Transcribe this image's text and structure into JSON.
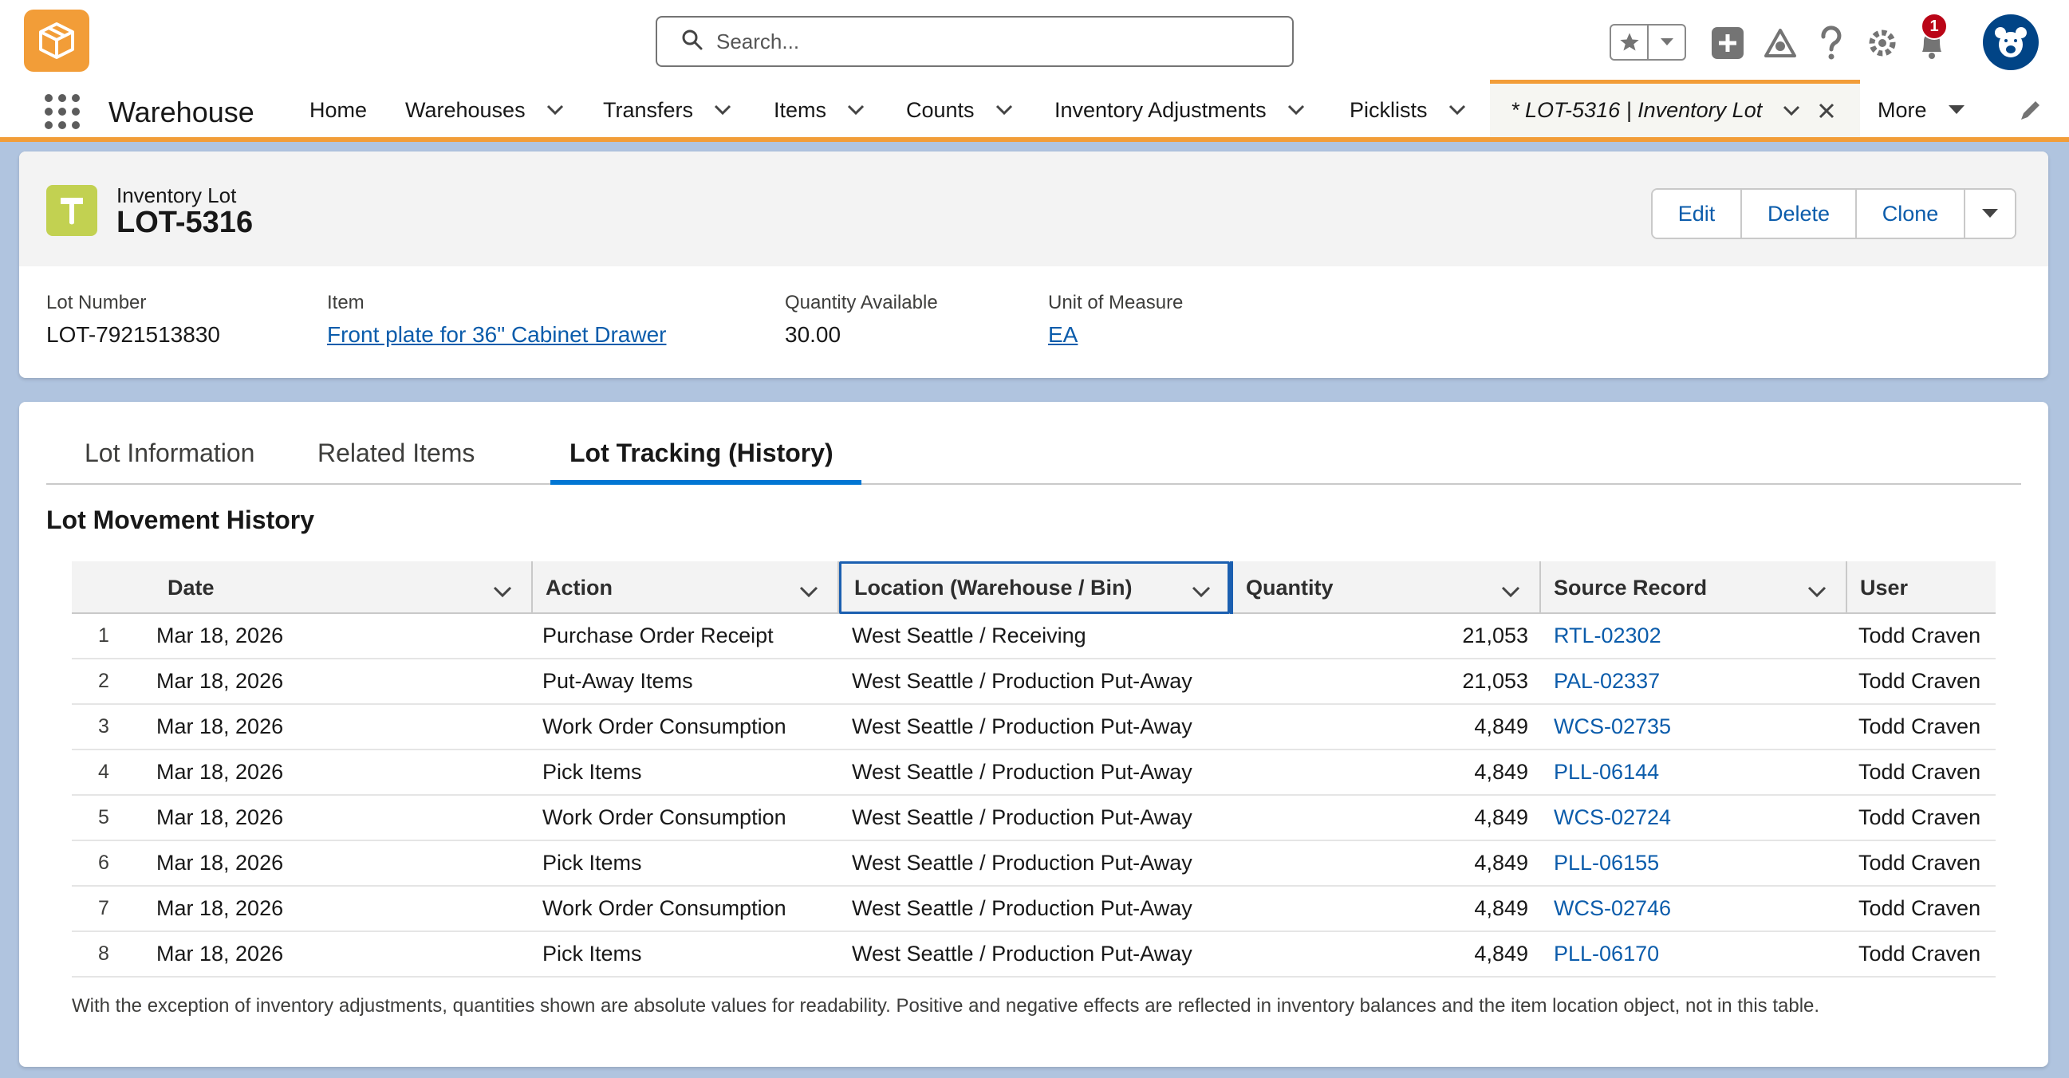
{
  "header": {
    "search_placeholder": "Search...",
    "notification_count": "1"
  },
  "nav": {
    "app_name": "Warehouse",
    "items": [
      {
        "label": "Home"
      },
      {
        "label": "Warehouses"
      },
      {
        "label": "Transfers"
      },
      {
        "label": "Items"
      },
      {
        "label": "Counts"
      },
      {
        "label": "Inventory Adjustments"
      },
      {
        "label": "Picklists"
      }
    ],
    "active_tab": "* LOT-5316 | Inventory Lot",
    "more_label": "More"
  },
  "record": {
    "object_label": "Inventory Lot",
    "title": "LOT-5316",
    "actions": {
      "edit": "Edit",
      "delete": "Delete",
      "clone": "Clone"
    },
    "fields": [
      {
        "label": "Lot Number",
        "value": "LOT-7921513830"
      },
      {
        "label": "Item",
        "value": "Front plate for 36\" Cabinet Drawer"
      },
      {
        "label": "Quantity Available",
        "value": "30.00"
      },
      {
        "label": "Unit of Measure",
        "value": "EA"
      }
    ]
  },
  "tabs": [
    {
      "label": "Lot Information"
    },
    {
      "label": "Related Items"
    },
    {
      "label": "Lot Tracking (History)"
    }
  ],
  "history": {
    "title": "Lot Movement History",
    "columns": [
      "Date",
      "Action",
      "Location (Warehouse / Bin)",
      "Quantity",
      "Source Record",
      "User"
    ],
    "rows": [
      {
        "n": "1",
        "date": "Mar 18, 2026",
        "action": "Purchase Order Receipt",
        "location": "West Seattle / Receiving",
        "qty": "21,053",
        "source": "RTL-02302",
        "user": "Todd Craven"
      },
      {
        "n": "2",
        "date": "Mar 18, 2026",
        "action": "Put-Away Items",
        "location": "West Seattle / Production Put-Away",
        "qty": "21,053",
        "source": "PAL-02337",
        "user": "Todd Craven"
      },
      {
        "n": "3",
        "date": "Mar 18, 2026",
        "action": "Work Order Consumption",
        "location": "West Seattle / Production Put-Away",
        "qty": "4,849",
        "source": "WCS-02735",
        "user": "Todd Craven"
      },
      {
        "n": "4",
        "date": "Mar 18, 2026",
        "action": "Pick Items",
        "location": "West Seattle / Production Put-Away",
        "qty": "4,849",
        "source": "PLL-06144",
        "user": "Todd Craven"
      },
      {
        "n": "5",
        "date": "Mar 18, 2026",
        "action": "Work Order Consumption",
        "location": "West Seattle / Production Put-Away",
        "qty": "4,849",
        "source": "WCS-02724",
        "user": "Todd Craven"
      },
      {
        "n": "6",
        "date": "Mar 18, 2026",
        "action": "Pick Items",
        "location": "West Seattle / Production Put-Away",
        "qty": "4,849",
        "source": "PLL-06155",
        "user": "Todd Craven"
      },
      {
        "n": "7",
        "date": "Mar 18, 2026",
        "action": "Work Order Consumption",
        "location": "West Seattle / Production Put-Away",
        "qty": "4,849",
        "source": "WCS-02746",
        "user": "Todd Craven"
      },
      {
        "n": "8",
        "date": "Mar 18, 2026",
        "action": "Pick Items",
        "location": "West Seattle / Production Put-Away",
        "qty": "4,849",
        "source": "PLL-06170",
        "user": "Todd Craven"
      }
    ],
    "footnote": "With the exception of inventory adjustments, quantities shown are absolute values for readability. Positive and negative effects are reflected in inventory balances and the item location object, not in this table."
  }
}
